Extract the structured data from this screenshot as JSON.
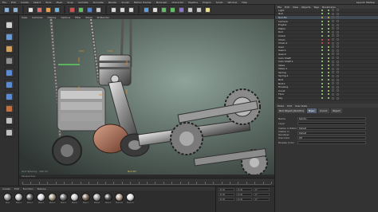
{
  "menubar": {
    "items": [
      "File",
      "Edit",
      "Create",
      "Select",
      "Tools",
      "Mesh",
      "Snap",
      "Animate",
      "Simulate",
      "Render",
      "Sculpt",
      "Motion Tracker",
      "MoGraph",
      "Character",
      "Pipeline",
      "Plugins",
      "Script",
      "Window",
      "Help"
    ],
    "layout": "Layout:  Startup"
  },
  "viewport": {
    "menu": [
      "View",
      "Cameras",
      "Display",
      "Options",
      "Filter",
      "Panel",
      "ProRender"
    ],
    "label_1": "Null.Pin",
    "label_2": "Grid Spacing : 100 cm",
    "footer": "Perspective"
  },
  "materials": {
    "menu": [
      "Create",
      "Edit",
      "Function",
      "Texture"
    ],
    "items": [
      {
        "label": "Mat",
        "color": "#8a8a8a"
      },
      {
        "label": "Mat.1",
        "color": "#b7b7b7"
      },
      {
        "label": "Mat.2",
        "color": "#5c5c5c"
      },
      {
        "label": "Mat.3",
        "color": "#d8d8d8"
      },
      {
        "label": "Mat.4",
        "color": "#a39582"
      },
      {
        "label": "Mat.5",
        "color": "#6f6f6f"
      },
      {
        "label": "Mat.6",
        "color": "#c9c9c9"
      },
      {
        "label": "Mat.7",
        "color": "#7a6a5a"
      },
      {
        "label": "Mat.8",
        "color": "#9e9e9e"
      },
      {
        "label": "Mat.9",
        "color": "#4c4c4c"
      },
      {
        "label": "Mat.10",
        "color": "#b0a090"
      },
      {
        "label": "Mat.11",
        "color": "#e0e0e0"
      }
    ]
  },
  "coords": {
    "rows": [
      [
        "0 cm",
        "0 cm",
        "0 °"
      ],
      [
        "0 cm",
        "0 cm",
        "0 °"
      ],
      [
        "0 cm",
        "0 cm",
        "0 °"
      ]
    ]
  },
  "objects": {
    "menu": [
      "File",
      "Edit",
      "View",
      "Objects",
      "Tags",
      "Bookmarks"
    ],
    "rows": [
      {
        "name": "Light",
        "dot": "#9fe07f"
      },
      {
        "name": "Null",
        "dot": "#9fe07f"
      },
      {
        "name": "Null.Pin",
        "dot": "#e0b64f",
        "selected": true
      },
      {
        "name": "Camera",
        "dot": "#9fe07f"
      },
      {
        "name": "Engine",
        "dot": "#9fe07f"
      },
      {
        "name": "Piston",
        "dot": "#9fe07f"
      },
      {
        "name": "Rod",
        "dot": "#9fe07f"
      },
      {
        "name": "Crank",
        "dot": "#9fe07f"
      },
      {
        "name": "Chain",
        "dot": "#e05050"
      },
      {
        "name": "Chain.1",
        "dot": "#e05050"
      },
      {
        "name": "Gear",
        "dot": "#9fe07f"
      },
      {
        "name": "Gear.1",
        "dot": "#9fe07f"
      },
      {
        "name": "Gear.2",
        "dot": "#9fe07f"
      },
      {
        "name": "Cam Shaft",
        "dot": "#9fe07f"
      },
      {
        "name": "Cam Shaft.1",
        "dot": "#9fe07f"
      },
      {
        "name": "Valve",
        "dot": "#9fe07f"
      },
      {
        "name": "Valve.1",
        "dot": "#9fe07f"
      },
      {
        "name": "Spring",
        "dot": "#9fe07f"
      },
      {
        "name": "Spring.1",
        "dot": "#9fe07f"
      },
      {
        "name": "Bolt",
        "dot": "#9fe07f"
      },
      {
        "name": "Bolt.1",
        "dot": "#9fe07f"
      },
      {
        "name": "Housing",
        "dot": "#9fe07f"
      },
      {
        "name": "Cover",
        "dot": "#9fe07f"
      },
      {
        "name": "Floor",
        "dot": "#9fe07f"
      },
      {
        "name": "Sky",
        "dot": "#9fe07f"
      }
    ]
  },
  "attributes": {
    "menu": [
      "Mode",
      "Edit",
      "User Data"
    ],
    "title": "Null Object [Null.Pin]",
    "tabs": [
      "Basic",
      "Coord.",
      "Object"
    ],
    "rows": [
      {
        "label": "Name",
        "value": "Null.Pin"
      },
      {
        "label": "Layer",
        "value": ""
      },
      {
        "label": "Visible in Editor",
        "value": "Default"
      },
      {
        "label": "Visible in Renderer",
        "value": "Default"
      },
      {
        "label": "Use Color",
        "value": "Off"
      },
      {
        "label": "Display Color",
        "value": ""
      }
    ]
  }
}
